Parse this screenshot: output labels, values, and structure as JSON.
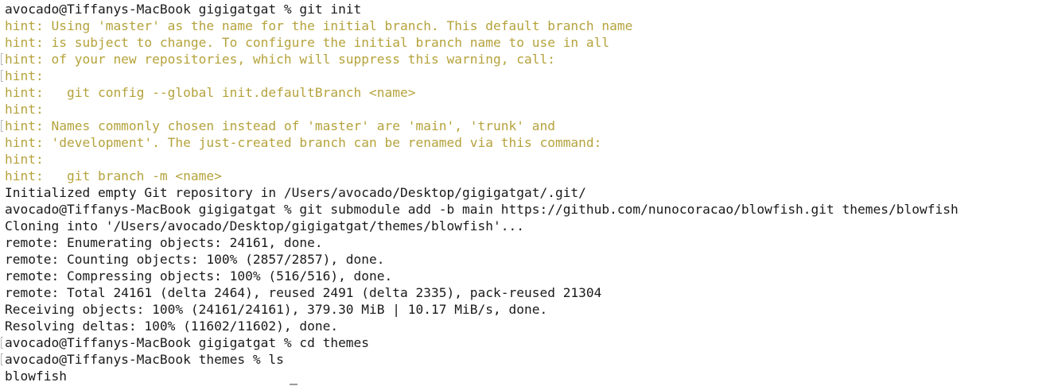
{
  "terminal": {
    "colors": {
      "background": "#ffffff",
      "text": "#1a1a1a",
      "hint": "#b5a33c"
    },
    "lines": [
      {
        "text": "avocado@Tiffanys-MacBook gigigatgat % git init",
        "type": "command",
        "mark": false
      },
      {
        "text": "hint: Using 'master' as the name for the initial branch. This default branch name",
        "type": "hint",
        "mark": false
      },
      {
        "text": "hint: is subject to change. To configure the initial branch name to use in all",
        "type": "hint",
        "mark": false
      },
      {
        "text": "hint: of your new repositories, which will suppress this warning, call:",
        "type": "hint",
        "mark": true
      },
      {
        "text": "hint:",
        "type": "hint",
        "mark": true
      },
      {
        "text": "hint:   git config --global init.defaultBranch <name>",
        "type": "hint",
        "mark": false
      },
      {
        "text": "hint:",
        "type": "hint",
        "mark": false
      },
      {
        "text": "hint: Names commonly chosen instead of 'master' are 'main', 'trunk' and",
        "type": "hint",
        "mark": true
      },
      {
        "text": "hint: 'development'. The just-created branch can be renamed via this command:",
        "type": "hint",
        "mark": false
      },
      {
        "text": "hint:",
        "type": "hint",
        "mark": false
      },
      {
        "text": "hint:   git branch -m <name>",
        "type": "hint",
        "mark": false
      },
      {
        "text": "Initialized empty Git repository in /Users/avocado/Desktop/gigigatgat/.git/",
        "type": "output",
        "mark": false
      },
      {
        "text": "avocado@Tiffanys-MacBook gigigatgat % git submodule add -b main https://github.com/nunocoracao/blowfish.git themes/blowfish",
        "type": "command",
        "mark": false
      },
      {
        "text": "Cloning into '/Users/avocado/Desktop/gigigatgat/themes/blowfish'...",
        "type": "output",
        "mark": false
      },
      {
        "text": "remote: Enumerating objects: 24161, done.",
        "type": "output",
        "mark": false
      },
      {
        "text": "remote: Counting objects: 100% (2857/2857), done.",
        "type": "output",
        "mark": false
      },
      {
        "text": "remote: Compressing objects: 100% (516/516), done.",
        "type": "output",
        "mark": false
      },
      {
        "text": "remote: Total 24161 (delta 2464), reused 2491 (delta 2335), pack-reused 21304",
        "type": "output",
        "mark": false
      },
      {
        "text": "Receiving objects: 100% (24161/24161), 379.30 MiB | 10.17 MiB/s, done.",
        "type": "output",
        "mark": false
      },
      {
        "text": "Resolving deltas: 100% (11602/11602), done.",
        "type": "output",
        "mark": false
      },
      {
        "text": "avocado@Tiffanys-MacBook gigigatgat % cd themes",
        "type": "command",
        "mark": true
      },
      {
        "text": "avocado@Tiffanys-MacBook themes % ls",
        "type": "command",
        "mark": true
      },
      {
        "text": "blowfish",
        "type": "output",
        "mark": false
      }
    ]
  }
}
